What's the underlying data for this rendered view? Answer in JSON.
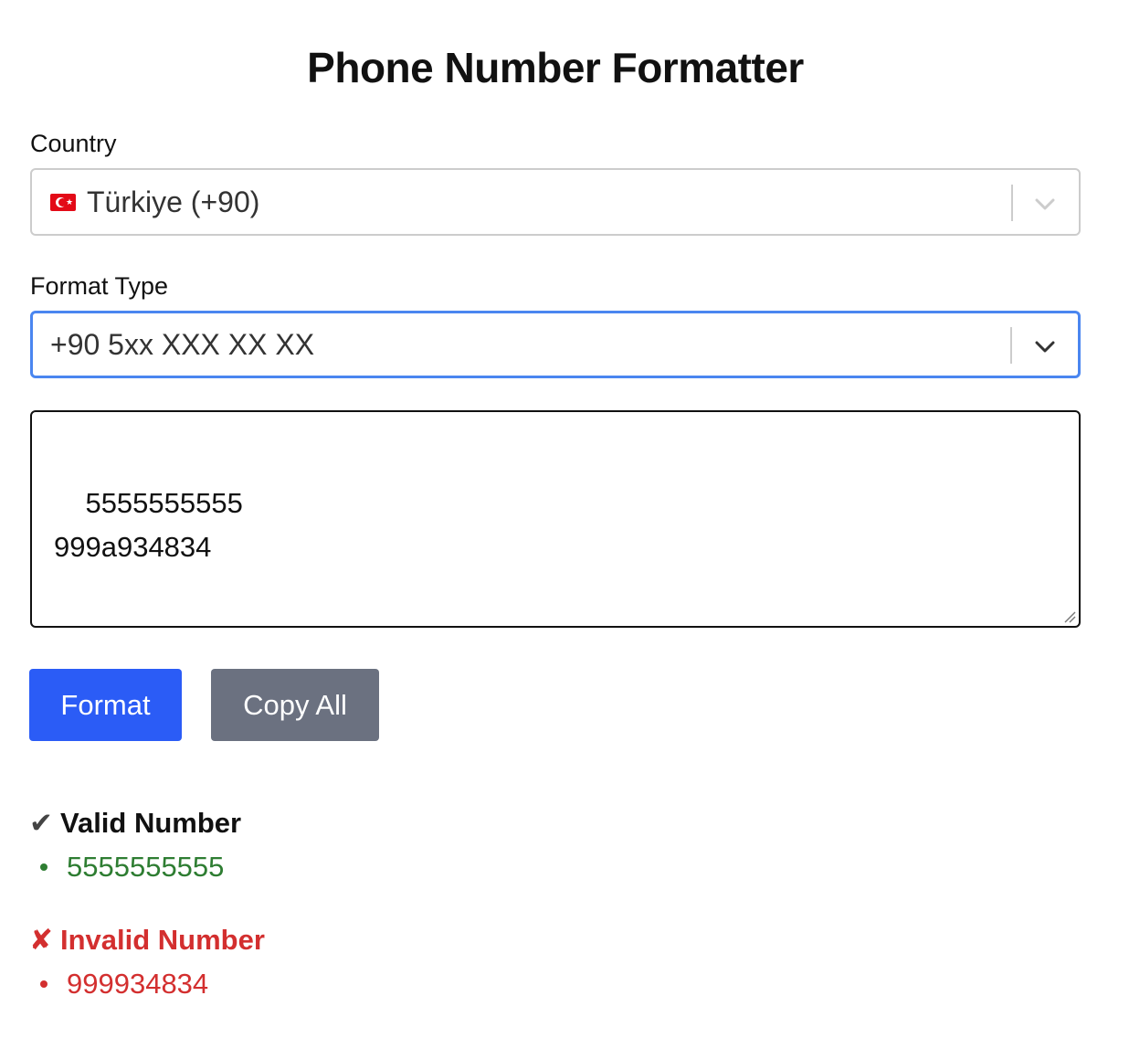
{
  "page": {
    "title": "Phone Number Formatter"
  },
  "country": {
    "label": "Country",
    "selected": "Türkiye (+90)",
    "flag_icon": "turkey-flag-icon"
  },
  "format_type": {
    "label": "Format Type",
    "selected": "+90 5xx XXX XX XX"
  },
  "input": {
    "value": "5555555555\n999a934834"
  },
  "buttons": {
    "format_label": "Format",
    "copy_all_label": "Copy All"
  },
  "results": {
    "valid": {
      "heading": "Valid Number",
      "mark": "✔",
      "items": [
        "5555555555"
      ]
    },
    "invalid": {
      "heading": "Invalid Number",
      "mark": "✘",
      "items": [
        "999934834"
      ]
    }
  },
  "colors": {
    "format_button": "#2b5cf6",
    "copy_button": "#6b7180",
    "focus_border": "#4a86f0",
    "valid": "#2e7d32",
    "invalid": "#d32f2f"
  }
}
